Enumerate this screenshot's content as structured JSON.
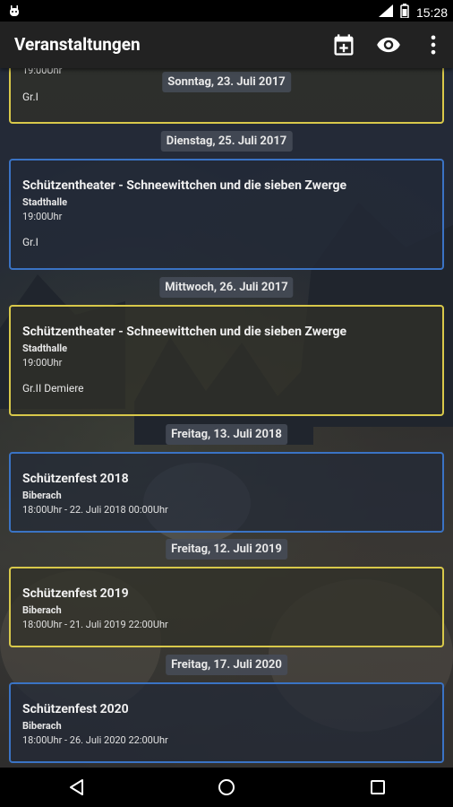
{
  "status": {
    "time": "15:28"
  },
  "appbar": {
    "title": "Veranstaltungen",
    "icons": [
      "calendar-add-icon",
      "eye-icon",
      "more-vert-icon"
    ]
  },
  "events": [
    {
      "date": "Sonntag, 23. Juli 2017",
      "style": "yellow",
      "title": "",
      "location": "",
      "time": "19:00Uhr",
      "note": "Gr.I"
    },
    {
      "date": "Dienstag, 25. Juli 2017",
      "style": "blue",
      "title": "Schützentheater - Schneewittchen und die sieben Zwerge",
      "location": "Stadthalle",
      "time": "19:00Uhr",
      "note": "Gr.I"
    },
    {
      "date": "Mittwoch, 26. Juli 2017",
      "style": "yellow",
      "title": "Schützentheater - Schneewittchen und die sieben Zwerge",
      "location": "Stadthalle",
      "time": "19:00Uhr",
      "note": "Gr.II Demiere"
    },
    {
      "date": "Freitag, 13. Juli 2018",
      "style": "blue",
      "title": "Schützenfest 2018",
      "location": "Biberach",
      "time": "18:00Uhr - 22. Juli 2018 00:00Uhr",
      "note": ""
    },
    {
      "date": "Freitag, 12. Juli 2019",
      "style": "yellow",
      "title": "Schützenfest 2019",
      "location": "Biberach",
      "time": "18:00Uhr - 21. Juli 2019 22:00Uhr",
      "note": ""
    },
    {
      "date": "Freitag, 17. Juli 2020",
      "style": "blue",
      "title": "Schützenfest 2020",
      "location": "Biberach",
      "time": "18:00Uhr - 26. Juli 2020 22:00Uhr",
      "note": ""
    }
  ],
  "colors": {
    "blue_border": "#3a73c4",
    "yellow_border": "#d8c84a"
  }
}
